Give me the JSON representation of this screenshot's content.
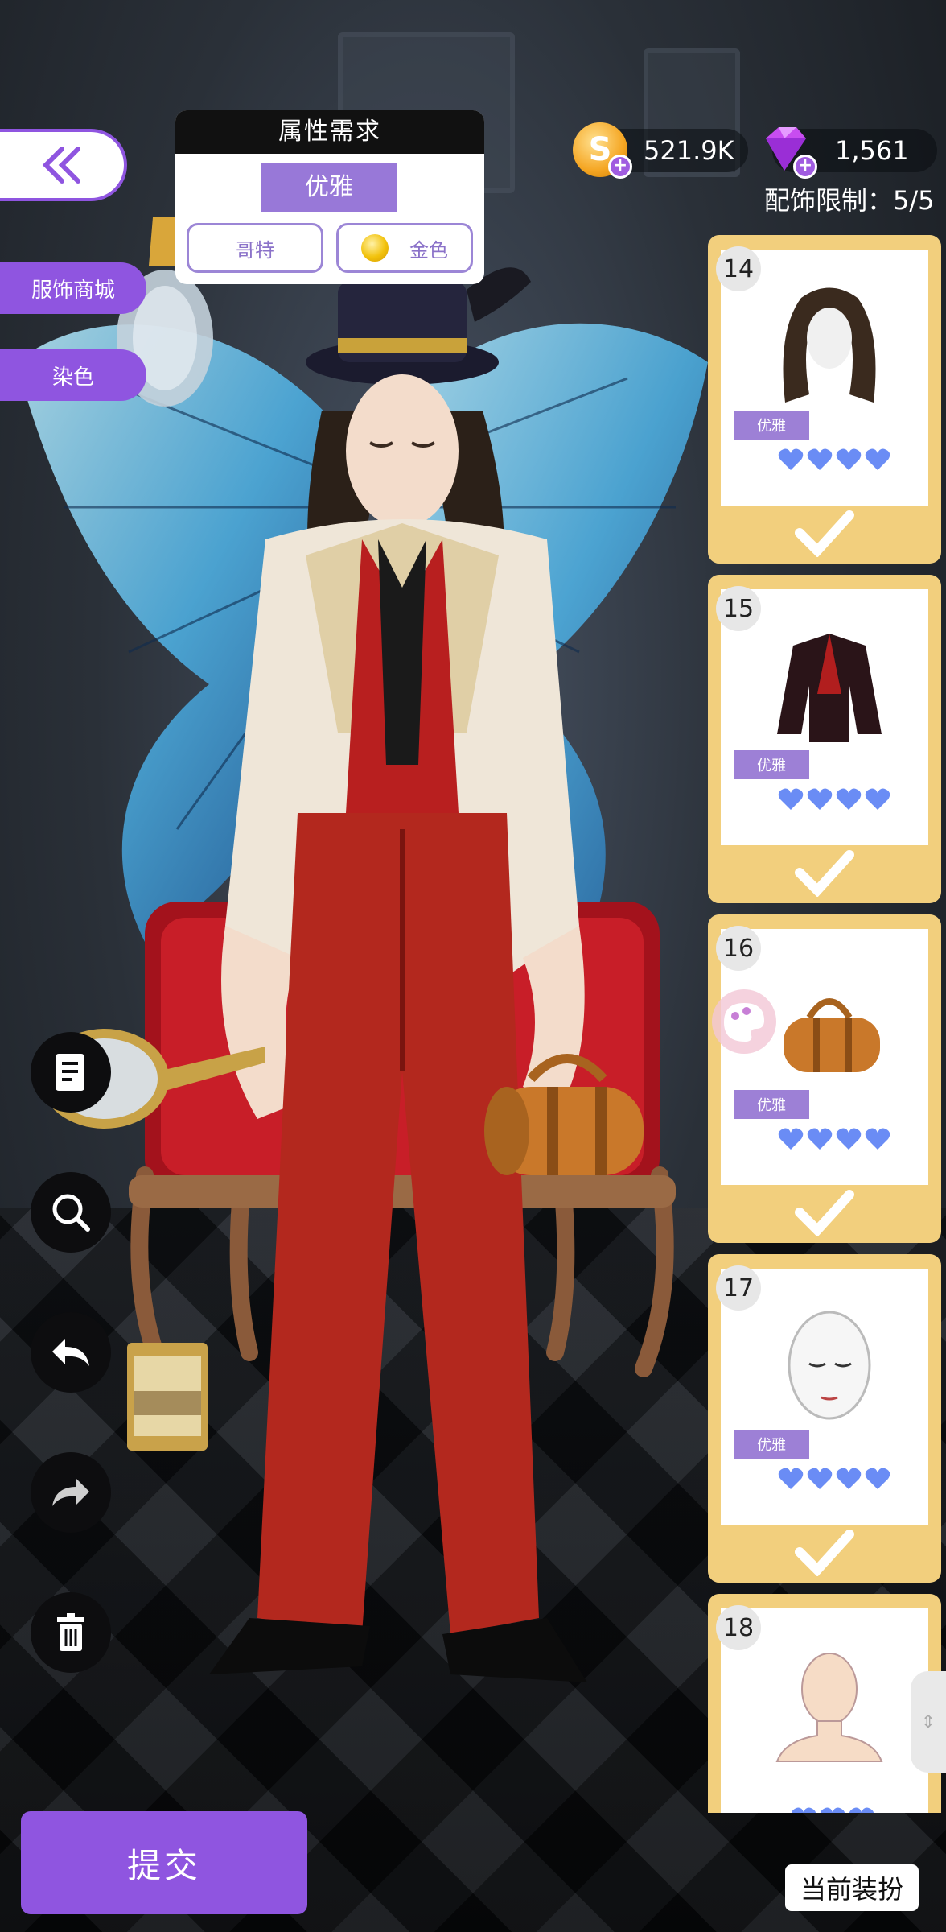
{
  "header": {
    "back_icon": "double-chevron-left-icon",
    "requirement": {
      "title": "属性需求",
      "main_attribute": "优雅",
      "chips": [
        "哥特",
        "金色"
      ]
    },
    "currency": {
      "gold": "521.9K",
      "gems": "1,561"
    },
    "accessory_limit": "配饰限制：5/5"
  },
  "sidebar": {
    "shop_label": "服饰商城",
    "dye_label": "染色"
  },
  "tools": [
    {
      "name": "notes-icon"
    },
    {
      "name": "zoom-icon"
    },
    {
      "name": "undo-icon"
    },
    {
      "name": "redo-icon"
    },
    {
      "name": "trash-icon"
    }
  ],
  "items": [
    {
      "number": "14",
      "badge": "优雅",
      "hearts": 4,
      "selected": true,
      "kind": "hair"
    },
    {
      "number": "15",
      "badge": "优雅",
      "hearts": 4,
      "selected": true,
      "kind": "jacket"
    },
    {
      "number": "16",
      "badge": "优雅",
      "hearts": 4,
      "selected": true,
      "kind": "bag"
    },
    {
      "number": "17",
      "badge": "优雅",
      "hearts": 4,
      "selected": true,
      "kind": "face"
    },
    {
      "number": "18",
      "badge": "",
      "hearts": 3,
      "selected": false,
      "kind": "body"
    }
  ],
  "footer": {
    "submit_label": "提交",
    "current_outfit_label": "当前装扮"
  },
  "colors": {
    "accent": "#8f55e0",
    "card_bg": "#f2cf7d",
    "badge": "#9d80d6",
    "heart": "#6a8cf5"
  }
}
